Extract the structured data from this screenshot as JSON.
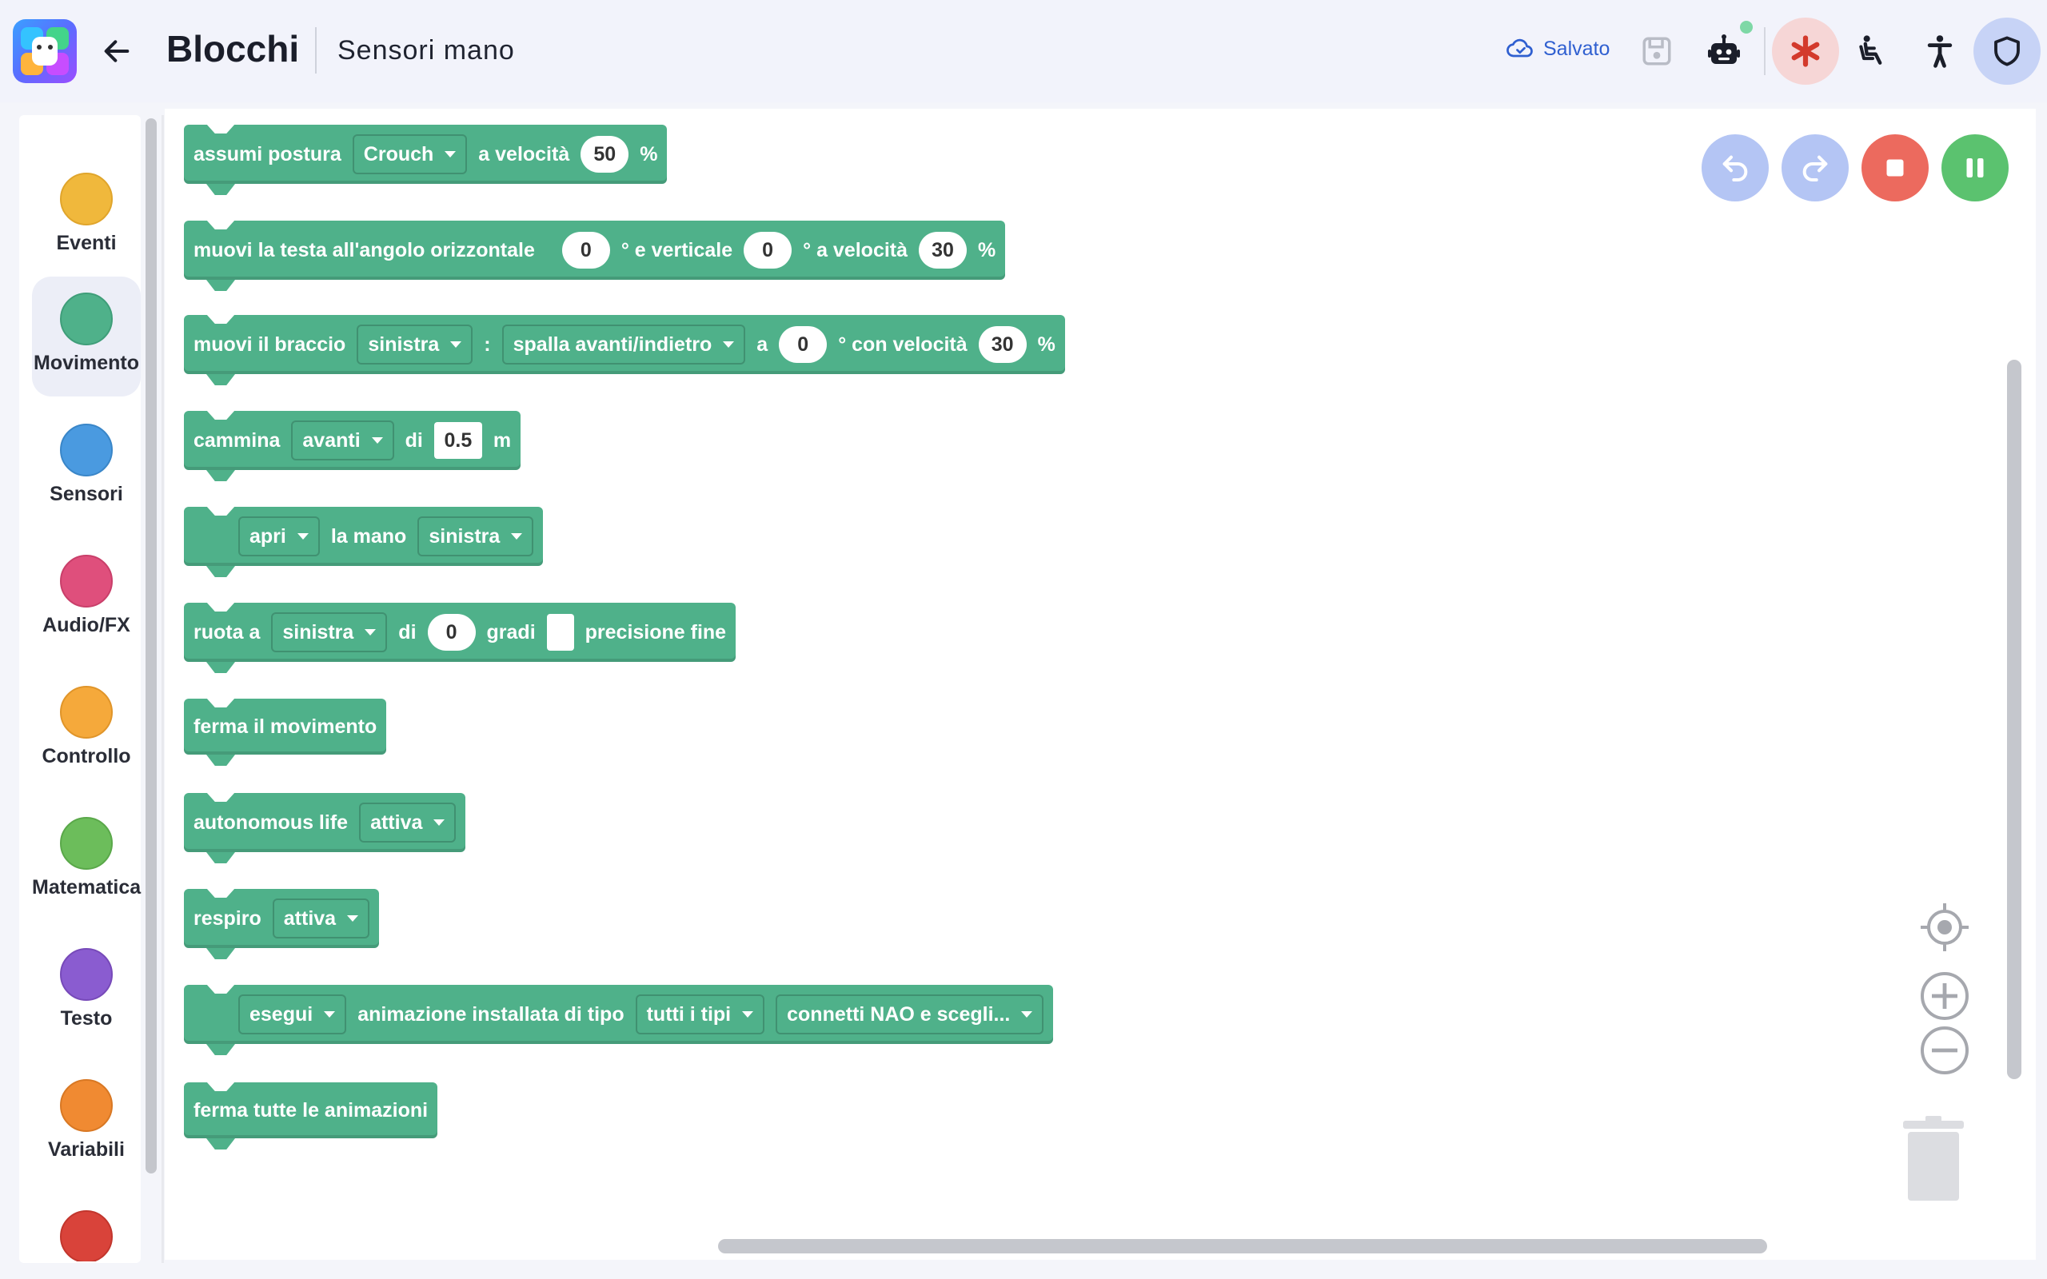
{
  "header": {
    "title": "Blocchi",
    "subtitle": "Sensori mano",
    "saved_label": "Salvato"
  },
  "palette": {
    "categories": [
      {
        "label": "Eventi",
        "color": "#f0b83c"
      },
      {
        "label": "Movimento",
        "color": "#4fb18a",
        "active": true
      },
      {
        "label": "Sensori",
        "color": "#4a9ae0"
      },
      {
        "label": "Audio/FX",
        "color": "#df4f7c"
      },
      {
        "label": "Controllo",
        "color": "#f5a93b"
      },
      {
        "label": "Matematica",
        "color": "#6cbd5b"
      },
      {
        "label": "Testo",
        "color": "#8a5cd0"
      },
      {
        "label": "Variabili",
        "color": "#f08a32"
      },
      {
        "label": "",
        "color": "#d9433a"
      }
    ]
  },
  "blocks": {
    "b1": {
      "t1": "assumi postura",
      "dd1": "Crouch",
      "t2": "a velocità",
      "v1": "50",
      "t3": "%"
    },
    "b2": {
      "t1": "muovi la testa all'angolo orizzontale",
      "v1": "0",
      "t2": "° e verticale",
      "v2": "0",
      "t3": "° a velocità",
      "v3": "30",
      "t4": "%"
    },
    "b3": {
      "t1": "muovi il braccio",
      "dd1": "sinistra",
      "t2": ":",
      "dd2": "spalla avanti/indietro",
      "t3": "a",
      "v1": "0",
      "t4": "° con velocità",
      "v2": "30",
      "t5": "%"
    },
    "b4": {
      "t1": "cammina",
      "dd1": "avanti",
      "t2": "di",
      "v1": "0.5",
      "t3": "m"
    },
    "b5": {
      "dd1": "apri",
      "t1": "la mano",
      "dd2": "sinistra"
    },
    "b6": {
      "t1": "ruota a",
      "dd1": "sinistra",
      "t2": "di",
      "v1": "0",
      "t3": "gradi",
      "t4": "precisione fine"
    },
    "b7": {
      "t1": "ferma il movimento"
    },
    "b8": {
      "t1": "autonomous life",
      "dd1": "attiva"
    },
    "b9": {
      "t1": "respiro",
      "dd1": "attiva"
    },
    "b10": {
      "dd1": "esegui",
      "t1": "animazione installata di tipo",
      "dd2": "tutti i tipi",
      "dd3": "connetti NAO e scegli..."
    },
    "b11": {
      "t1": "ferma tutte le animazioni"
    }
  },
  "colors": {
    "motion_block": "#4fb18a",
    "undo_redo": "#b4c5f4",
    "stop": "#ec6a5e",
    "pause": "#5bc26f",
    "saved_accent": "#2f5fd0"
  }
}
